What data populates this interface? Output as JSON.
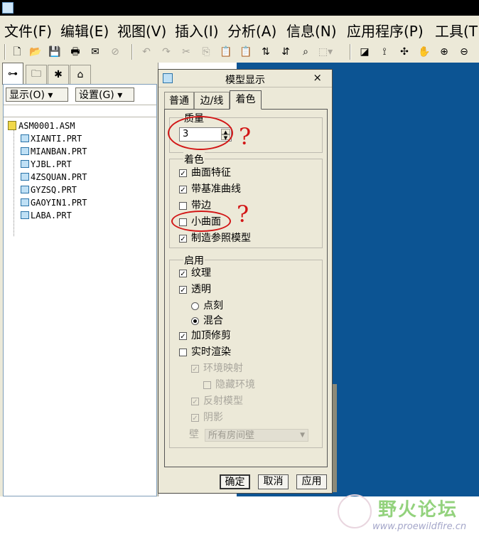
{
  "menubar": {
    "items": [
      "文件(F)",
      "编辑(E)",
      "视图(V)",
      "插入(I)",
      "分析(A)",
      "信息(N)",
      "应用程序(P)",
      "工具(T"
    ]
  },
  "toolbar": {
    "icons": [
      "new-icon",
      "open-icon",
      "save-icon",
      "print-icon",
      "send-icon",
      "erase-icon",
      "undo-icon",
      "redo-icon",
      "cut-icon",
      "copy-icon",
      "paste-icon",
      "paste-special-icon",
      "regenerate-icon",
      "regen-manager-icon",
      "find-icon",
      "select-box-icon",
      "view-icon",
      "datum-icon",
      "spin-center-icon",
      "pan-icon",
      "zoom-in-icon",
      "zoom-out-icon"
    ]
  },
  "left_panel": {
    "display_button": "显示(O)",
    "settings_button": "设置(G)",
    "tree": {
      "root": "ASM0001.ASM",
      "children": [
        "XIANTI.PRT",
        "MIANBAN.PRT",
        "YJBL.PRT",
        "4ZSQUAN.PRT",
        "GYZSQ.PRT",
        "GAOYIN1.PRT",
        "LABA.PRT"
      ]
    }
  },
  "dialog": {
    "title": "模型显示",
    "close": "×",
    "tabs": [
      "普通",
      "边/线",
      "着色"
    ],
    "active_tab": "着色",
    "quality": {
      "label": "质量",
      "value": "3"
    },
    "shading": {
      "label": "着色",
      "options": [
        {
          "label": "曲面特征",
          "checked": "✓"
        },
        {
          "label": "带基准曲线",
          "checked": "✓"
        },
        {
          "label": "带边",
          "checked": ""
        },
        {
          "label": "小曲面",
          "checked": ""
        },
        {
          "label": "制造参照模型",
          "checked": "✓"
        }
      ]
    },
    "enable": {
      "label": "启用",
      "texture": {
        "label": "纹理",
        "checked": "✓"
      },
      "transparency": {
        "label": "透明",
        "checked": "✓"
      },
      "radio_dither": "点刻",
      "radio_blend": "混合",
      "capping": {
        "label": "加顶修剪",
        "checked": "✓"
      },
      "realtime": {
        "label": "实时渲染",
        "checked": ""
      },
      "env_map": {
        "label": "环境映射",
        "checked": "✓"
      },
      "hide_env": {
        "label": "隐藏环境",
        "checked": ""
      },
      "reflect": {
        "label": "反射模型",
        "checked": "✓"
      },
      "shadow": {
        "label": "阴影",
        "checked": "✓"
      },
      "wall_label": "壁",
      "wall_value": "所有房间壁"
    },
    "buttons": {
      "ok": "确定",
      "cancel": "取消",
      "apply": "应用"
    }
  },
  "annotations": {
    "question_mark": "?"
  },
  "watermark": {
    "site_name": "野火论坛",
    "url": "www.proewildfire.cn"
  }
}
